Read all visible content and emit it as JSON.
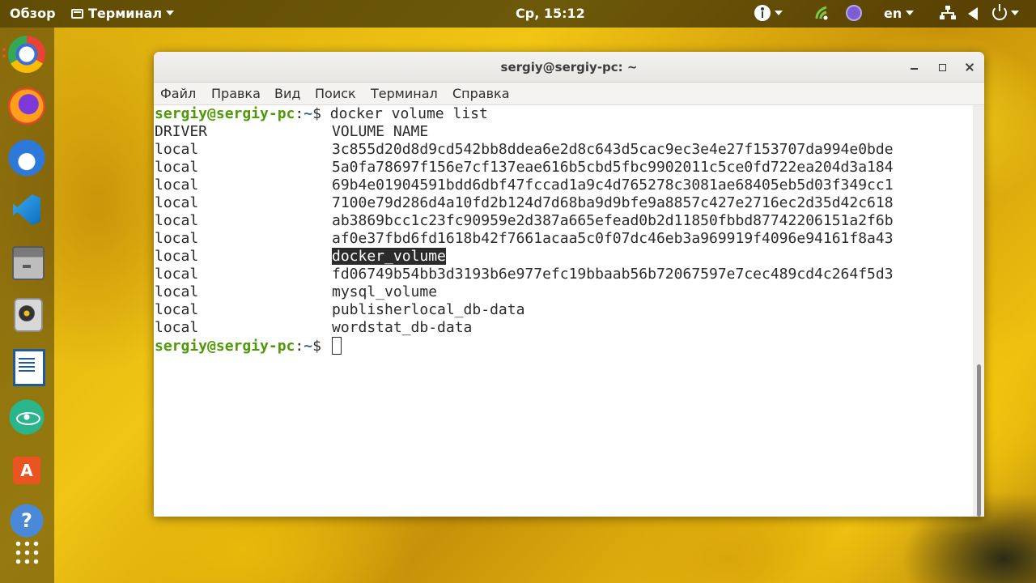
{
  "topbar": {
    "activities": "Обзор",
    "app_menu": "Терминал",
    "clock": "Ср, 15:12",
    "language": "en"
  },
  "dock": {
    "icons": [
      "chrome-icon",
      "firefox-icon",
      "thunderbird-icon",
      "vscode-icon",
      "files-icon",
      "rhythmbox-icon",
      "writer-icon",
      "atom-icon",
      "software-store-icon",
      "help-icon",
      "app-grid-icon"
    ]
  },
  "window": {
    "title": "sergiy@sergiy-pc: ~",
    "menu": [
      "Файл",
      "Правка",
      "Вид",
      "Поиск",
      "Терминал",
      "Справка"
    ]
  },
  "terminal": {
    "prompt_user": "sergiy@sergiy-pc",
    "prompt_colon": ":",
    "prompt_path": "~",
    "prompt_dollar": "$ ",
    "command": "docker volume list",
    "header_driver": "DRIVER",
    "header_name": "VOLUME NAME",
    "rows": [
      {
        "driver": "local",
        "name": "3c855d20d8d9cd542bb8ddea6e2d8c643d5cac9ec3e4e27f153707da994e0bde"
      },
      {
        "driver": "local",
        "name": "5a0fa78697f156e7cf137eae616b5cbd5fbc9902011c5ce0fd722ea204d3a184"
      },
      {
        "driver": "local",
        "name": "69b4e01904591bdd6dbf47fccad1a9c4d765278c3081ae68405eb5d03f349cc1"
      },
      {
        "driver": "local",
        "name": "7100e79d286d4a10fd2b124d7d68ba9d9bfe9a8857c427e2716ec2d35d42c618"
      },
      {
        "driver": "local",
        "name": "ab3869bcc1c23fc90959e2d387a665efead0b2d11850fbbd87742206151a2f6b"
      },
      {
        "driver": "local",
        "name": "af0e37fbd6fd1618b42f7661acaa5c0f07dc46eb3a969919f4096e94161f8a43"
      },
      {
        "driver": "local",
        "name": "docker_volume"
      },
      {
        "driver": "local",
        "name": "fd06749b54bb3d3193b6e977efc19bbaab56b72067597e7cec489cd4c264f5d3"
      },
      {
        "driver": "local",
        "name": "mysql_volume"
      },
      {
        "driver": "local",
        "name": "publisherlocal_db-data"
      },
      {
        "driver": "local",
        "name": "wordstat_db-data"
      }
    ]
  },
  "colors": {
    "prompt_user": "#4e9a06",
    "prompt_path": "#3465a4",
    "accent": "#e95420"
  }
}
